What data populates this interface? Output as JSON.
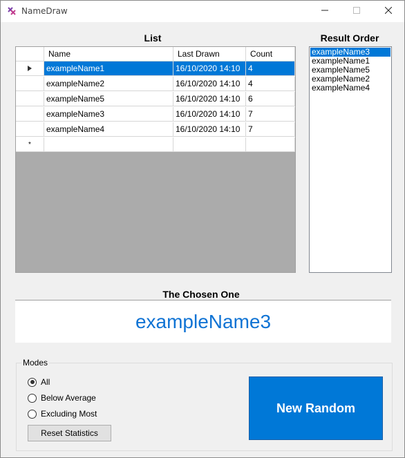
{
  "window": {
    "title": "NameDraw",
    "icon": "app-logo-icon",
    "controls": {
      "minimize": "minimize-icon",
      "maximize": "maximize-icon",
      "close": "close-icon"
    }
  },
  "list": {
    "title": "List",
    "columns": [
      "Name",
      "Last Drawn",
      "Count"
    ],
    "rows": [
      {
        "name": "exampleName1",
        "last_drawn": "16/10/2020 14:10",
        "count": "4",
        "selected": true
      },
      {
        "name": "exampleName2",
        "last_drawn": "16/10/2020 14:10",
        "count": "4"
      },
      {
        "name": "exampleName5",
        "last_drawn": "16/10/2020 14:10",
        "count": "6"
      },
      {
        "name": "exampleName3",
        "last_drawn": "16/10/2020 14:10",
        "count": "7"
      },
      {
        "name": "exampleName4",
        "last_drawn": "16/10/2020 14:10",
        "count": "7"
      }
    ],
    "new_row_marker": "*"
  },
  "result_order": {
    "title": "Result Order",
    "items": [
      "exampleName3",
      "exampleName1",
      "exampleName5",
      "exampleName2",
      "exampleName4"
    ],
    "selected_index": 0
  },
  "chosen": {
    "title": "The Chosen One",
    "name": "exampleName3"
  },
  "modes": {
    "legend": "Modes",
    "options": [
      "All",
      "Below Average",
      "Excluding Most"
    ],
    "selected": "All",
    "reset_label": "Reset Statistics"
  },
  "new_random_label": "New Random",
  "colors": {
    "accent": "#0078d7",
    "chosen_text": "#0f73d4"
  }
}
